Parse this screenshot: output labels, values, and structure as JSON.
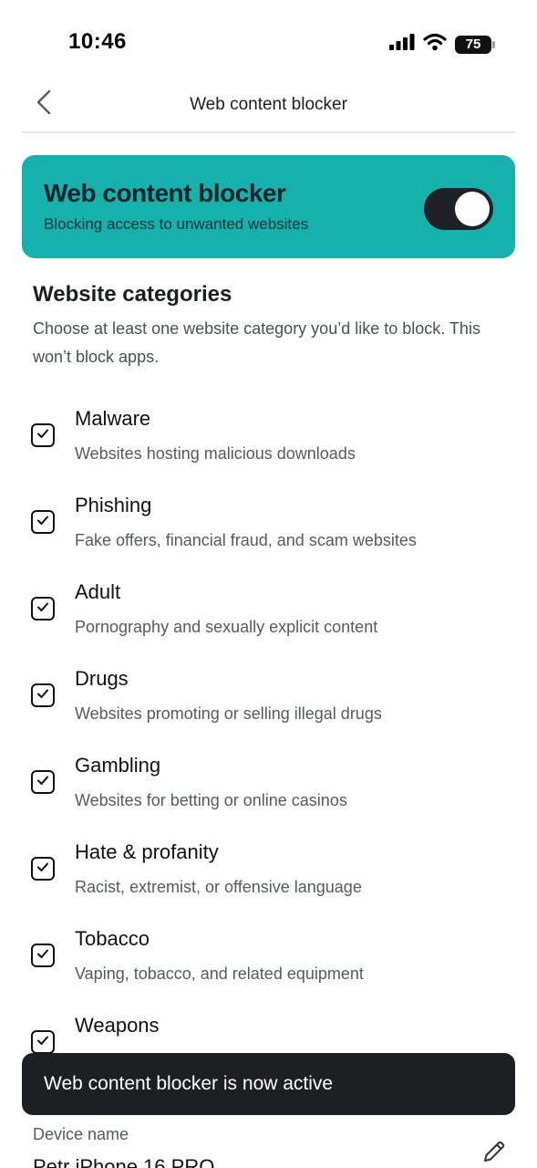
{
  "status_bar": {
    "time": "10:46",
    "battery": "75"
  },
  "nav": {
    "title": "Web content blocker"
  },
  "hero": {
    "title": "Web content blocker",
    "subtitle": "Blocking access to unwanted websites",
    "toggle_on": true,
    "color": "#16b1ad"
  },
  "section": {
    "title": "Website categories",
    "description": "Choose at least one website category you’d like to block. This won’t block apps."
  },
  "categories": [
    {
      "name": "Malware",
      "description": "Websites hosting malicious downloads",
      "checked": true
    },
    {
      "name": "Phishing",
      "description": "Fake offers, financial fraud, and scam websites",
      "checked": true
    },
    {
      "name": "Adult",
      "description": "Pornography and sexually explicit content",
      "checked": true
    },
    {
      "name": "Drugs",
      "description": "Websites promoting or selling illegal drugs",
      "checked": true
    },
    {
      "name": "Gambling",
      "description": "Websites for betting or online casinos",
      "checked": true
    },
    {
      "name": "Hate & profanity",
      "description": "Racist, extremist, or offensive language",
      "checked": true
    },
    {
      "name": "Tobacco",
      "description": "Vaping, tobacco, and related equipment",
      "checked": true
    },
    {
      "name": "Weapons",
      "description": "",
      "checked": true
    }
  ],
  "toast": {
    "message": "Web content blocker is now active"
  },
  "device": {
    "label": "Device name",
    "value": "Petr iPhone 16 PRO"
  }
}
